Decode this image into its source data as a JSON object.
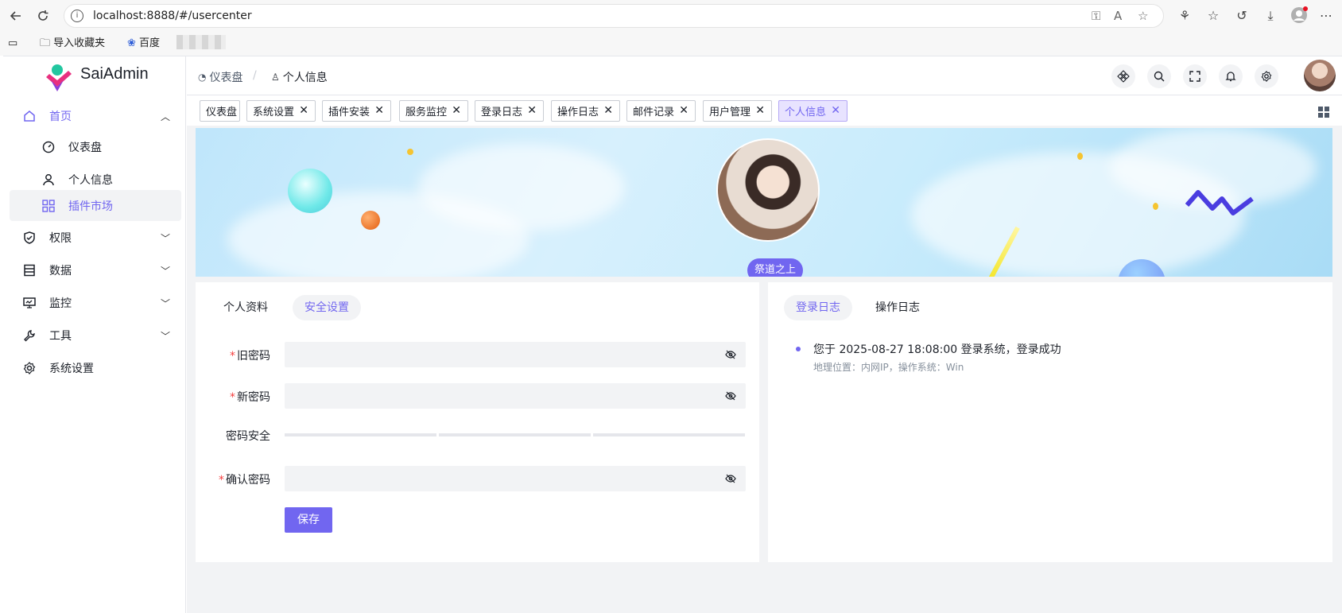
{
  "browser": {
    "url": "localhost:8888/#/usercenter",
    "bookmarks": [
      "导入收藏夹",
      "百度"
    ]
  },
  "app": {
    "logo_text": "SaiAdmin",
    "brand_color": "#7166f0"
  },
  "sidebar": {
    "items": [
      {
        "label": "首页",
        "icon": "home-icon",
        "expanded": true
      },
      {
        "label": "仪表盘",
        "icon": "dashboard-icon"
      },
      {
        "label": "个人信息",
        "icon": "user-icon"
      },
      {
        "label": "插件市场",
        "icon": "apps-icon",
        "active": true
      },
      {
        "label": "权限",
        "icon": "shield-icon"
      },
      {
        "label": "数据",
        "icon": "database-icon"
      },
      {
        "label": "监控",
        "icon": "monitor-icon"
      },
      {
        "label": "工具",
        "icon": "wrench-icon"
      },
      {
        "label": "系统设置",
        "icon": "settings-icon"
      }
    ]
  },
  "breadcrumb": [
    "仪表盘",
    "个人信息"
  ],
  "breadcrumb_sep": "/",
  "tabs": [
    {
      "label": "仪表盘"
    },
    {
      "label": "系统设置"
    },
    {
      "label": "插件安装"
    },
    {
      "label": "服务监控"
    },
    {
      "label": "登录日志"
    },
    {
      "label": "操作日志"
    },
    {
      "label": "邮件记录"
    },
    {
      "label": "用户管理"
    },
    {
      "label": "个人信息",
      "active": true
    }
  ],
  "profile": {
    "name": "祭道之上"
  },
  "left_card": {
    "tabs": [
      "个人资料",
      "安全设置"
    ],
    "active_tab": "安全设置",
    "fields": {
      "old_password": "旧密码",
      "new_password": "新密码",
      "strength": "密码安全",
      "confirm_password": "确认密码"
    },
    "required_mark": "*",
    "save_label": "保存"
  },
  "right_card": {
    "tabs": [
      "登录日志",
      "操作日志"
    ],
    "active_tab": "登录日志",
    "log": {
      "main": "您于 2025-08-27 18:08:00 登录系统，登录成功",
      "sub": "地理位置：内网IP，操作系统：Win"
    }
  }
}
